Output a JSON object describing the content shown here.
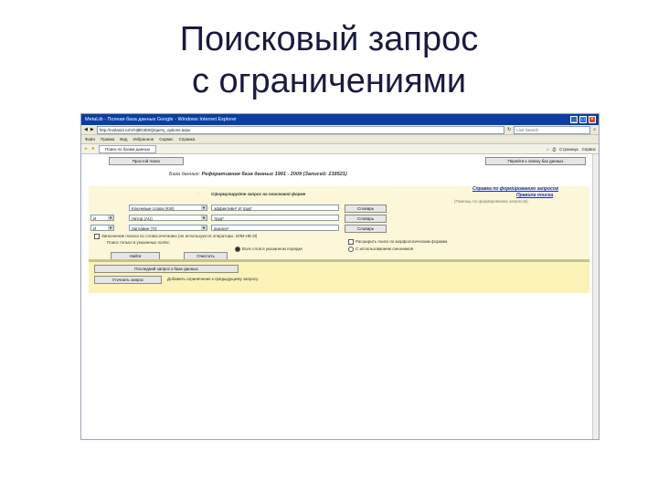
{
  "slide": {
    "title_line1": "Поисковый запрос",
    "title_line2": "с ограничениями"
  },
  "window": {
    "title": "MetaLib - Полная база данных Google - Windows Internet Explorer",
    "address": "http://ruslania.ru/V/Hj8D3E8Q/query_options.aspx",
    "search_placeholder": "Live Search",
    "menu": [
      "Файл",
      "Правка",
      "Вид",
      "Избранное",
      "Сервис",
      "Справка"
    ],
    "tab_label": "Поиск по базам данных",
    "tools": [
      "Страница",
      "Сервис"
    ]
  },
  "page": {
    "simple_search_button": "Простой поиск",
    "back_to_list_button": "Перейти к списку баз данных",
    "db_prefix": "База данных:",
    "db_name": "Реферативная база данных 1991 - 2009",
    "db_records": "(Записей: 218521)",
    "form_hint": "Сформулируйте запрос на поисковой форме",
    "help_link_line1": "Справка по формированию запросов",
    "help_link_line2": "Правила поиска",
    "help_hint": "(Помощь по формированию запросов)",
    "rows": [
      {
        "bool": "",
        "field": "Ключевые слова (KW)",
        "value": "эффективн* И труд*",
        "button": "Словарь"
      },
      {
        "bool": "И",
        "field": "Автор (AU)",
        "value": "труд*",
        "button": "Словарь"
      },
      {
        "bool": "И",
        "field": "Заглавие (TI)",
        "value": "анализ*",
        "button": "Словарь"
      }
    ],
    "option_exact": "Заполнение поиска по словосочетанию (не используются операторы: ИЛИ-НЕ-И)",
    "option_limit": "Поиск только в указанных полях:",
    "option_all_words": "Всех слов в указанном порядке",
    "option_morph": "Расширить поиск по морфологическим формам",
    "option_synonyms": "С использованием синонимов",
    "find_button": "Найти",
    "clear_button": "Очистить",
    "prev_query_button": "Последний запрос к базе данных",
    "refine_button": "Уточнить запрос",
    "refine_hint": "Добавить ограничение к предыдущему запросу"
  }
}
